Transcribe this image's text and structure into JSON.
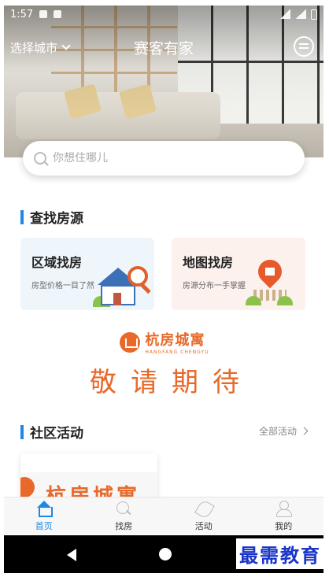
{
  "status_bar": {
    "time": "1:57"
  },
  "header": {
    "city_selector": "选择城市",
    "app_title": "赛客有家"
  },
  "search": {
    "placeholder": "你想住哪儿"
  },
  "find_section": {
    "title": "查找房源",
    "cards": [
      {
        "title": "区域找房",
        "subtitle": "房型价格一目了然"
      },
      {
        "title": "地图找房",
        "subtitle": "房源分布一手掌握"
      }
    ]
  },
  "brand": {
    "name_cn": "杭房城寓",
    "name_en": "HANGFANG CHENGYU",
    "coming_soon": "敬请期待"
  },
  "community_section": {
    "title": "社区活动",
    "more_label": "全部活动",
    "activity_banner_text": "杭房城寓"
  },
  "tabbar": {
    "items": [
      {
        "label": "首页",
        "icon": "home-icon",
        "active": true
      },
      {
        "label": "找房",
        "icon": "search-icon",
        "active": false
      },
      {
        "label": "活动",
        "icon": "leaf-icon",
        "active": false
      },
      {
        "label": "我的",
        "icon": "user-icon",
        "active": false
      }
    ]
  },
  "watermark": "最需教育",
  "colors": {
    "accent": "#1e88e5",
    "brand_orange": "#e8692a"
  }
}
